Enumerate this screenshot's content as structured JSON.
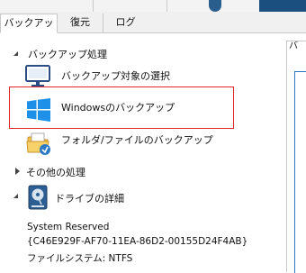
{
  "tabs": [
    {
      "label": "バックアップ",
      "active": true
    },
    {
      "label": "復元",
      "active": false
    },
    {
      "label": "ログ",
      "active": false
    }
  ],
  "backup_section": {
    "header": "バックアップ処理",
    "items": [
      {
        "label": "バックアップ対象の選択",
        "icon": "monitor-icon"
      },
      {
        "label": "Windowsのバックアップ",
        "icon": "windows-logo-icon"
      },
      {
        "label": "フォルダ/ファイルのバックアップ",
        "icon": "folder-icon"
      }
    ]
  },
  "other_section": {
    "header": "その他の処理"
  },
  "drive_section": {
    "header": "ドライブの詳細",
    "icon": "disk-icon",
    "drive_name": "System Reserved",
    "drive_id": "{C46E929F-AF70-11EA-86D2-00155D24F4AB}",
    "filesystem_label": "ファイルシステム: NTFS"
  },
  "right_pane": {
    "tab_stub": "バ"
  },
  "colors": {
    "highlight": "#e0262a",
    "accent": "#2b78c5",
    "windows_blue": "#1e90e8"
  }
}
